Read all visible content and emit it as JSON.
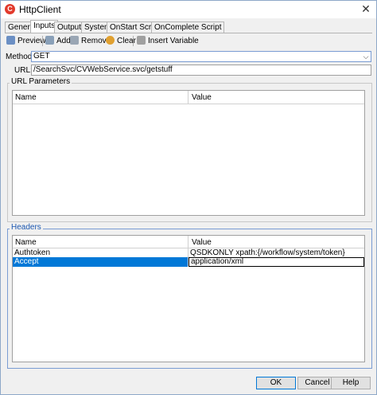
{
  "window": {
    "title": "HttpClient"
  },
  "tabs": [
    {
      "label": "General"
    },
    {
      "label": "Inputs",
      "active": true
    },
    {
      "label": "Outputs"
    },
    {
      "label": "System"
    },
    {
      "label": "OnStart Script"
    },
    {
      "label": "OnComplete Script"
    }
  ],
  "toolbar": {
    "preview": "Preview",
    "add": "Add",
    "remove": "Remove",
    "clear": "Clear",
    "insert_variable": "Insert Variable"
  },
  "method": {
    "label": "Method:",
    "value": "GET"
  },
  "url": {
    "label": "URL:",
    "value": "/SearchSvc/CVWebService.svc/getstuff"
  },
  "url_parameters": {
    "title": "URL Parameters",
    "columns": [
      "Name",
      "Value"
    ]
  },
  "headers": {
    "title": "Headers",
    "columns": [
      "Name",
      "Value"
    ],
    "rows": [
      {
        "name": "Authtoken",
        "value": "QSDKONLY xpath:{/workflow/system/token}"
      },
      {
        "name": "Accept",
        "value": "application/xml"
      }
    ]
  },
  "buttons": {
    "ok": "OK",
    "cancel": "Cancel",
    "help": "Help"
  },
  "colors": {
    "selection": "#0078d7",
    "title_icon": "#e23a2c",
    "group_border_active": "#7a9cd3"
  }
}
